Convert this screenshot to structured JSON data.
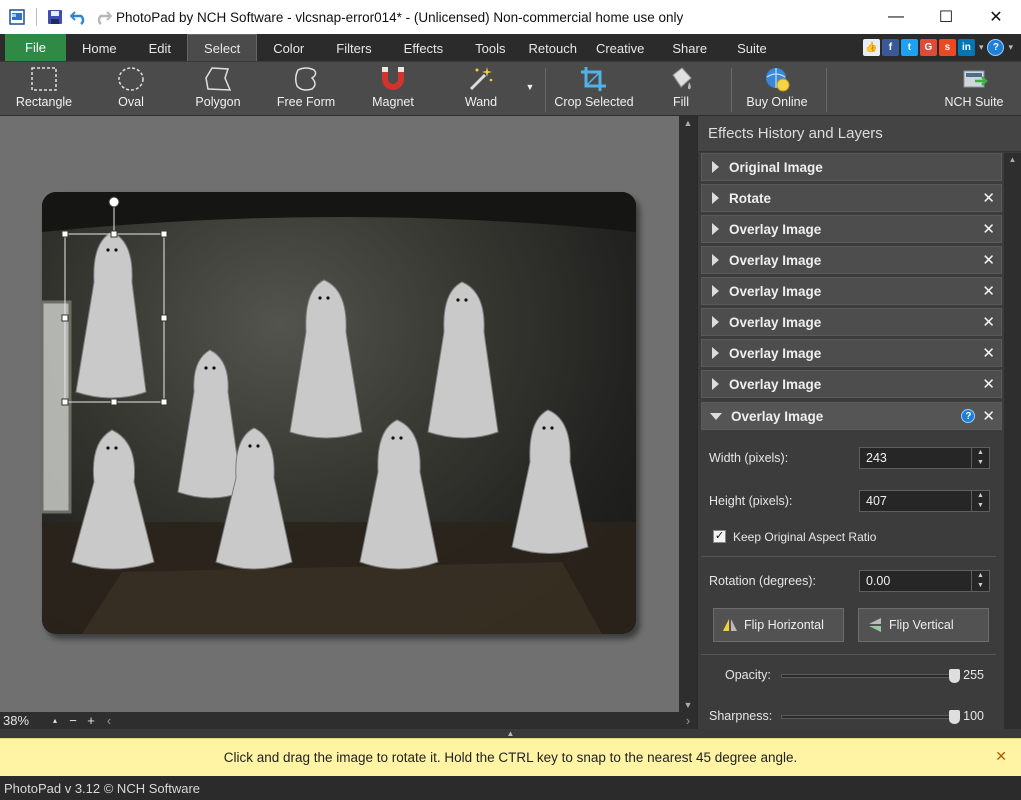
{
  "window": {
    "title": "PhotoPad by NCH Software - vlcsnap-error014* - (Unlicensed) Non-commercial home use only",
    "minimize": "—",
    "maximize": "☐",
    "close": "✕"
  },
  "menu": {
    "tabs": [
      {
        "label": "File"
      },
      {
        "label": "Home"
      },
      {
        "label": "Edit"
      },
      {
        "label": "Select"
      },
      {
        "label": "Color"
      },
      {
        "label": "Filters"
      },
      {
        "label": "Effects"
      },
      {
        "label": "Tools"
      },
      {
        "label": "Retouch"
      },
      {
        "label": "Creative"
      },
      {
        "label": "Share"
      },
      {
        "label": "Suite"
      }
    ],
    "active": "Select",
    "help": "?"
  },
  "toolbar": {
    "rectangle": "Rectangle",
    "oval": "Oval",
    "polygon": "Polygon",
    "free_form": "Free Form",
    "magnet": "Magnet",
    "wand": "Wand",
    "crop_selected": "Crop Selected",
    "fill": "Fill",
    "buy_online": "Buy Online",
    "nch_suite": "NCH Suite"
  },
  "canvas": {
    "zoom": "38%"
  },
  "panel": {
    "title": "Effects History and Layers",
    "layers": [
      {
        "label": "Original Image"
      },
      {
        "label": "Rotate"
      },
      {
        "label": "Overlay Image"
      },
      {
        "label": "Overlay Image"
      },
      {
        "label": "Overlay Image"
      },
      {
        "label": "Overlay Image"
      },
      {
        "label": "Overlay Image"
      },
      {
        "label": "Overlay Image"
      },
      {
        "label": "Overlay Image"
      }
    ],
    "props": {
      "width_label": "Width (pixels):",
      "width_value": "243",
      "height_label": "Height (pixels):",
      "height_value": "407",
      "keep_aspect_label": "Keep Original Aspect Ratio",
      "keep_aspect_checked": true,
      "rotation_label": "Rotation (degrees):",
      "rotation_value": "0.00",
      "flip_h": "Flip Horizontal",
      "flip_v": "Flip Vertical",
      "opacity_label": "Opacity:",
      "opacity_value": "255",
      "sharpness_label": "Sharpness:",
      "sharpness_value": "100"
    }
  },
  "hint": {
    "text": "Click and drag the image to rotate it. Hold the CTRL key to snap to the nearest 45 degree angle."
  },
  "status": {
    "text": "PhotoPad v 3.12 © NCH Software"
  },
  "colors": {
    "file_tab": "#2f8a46",
    "hint_bg": "#fff4a4",
    "panel_bg": "#3c3c3c",
    "canvas_bg": "#707070"
  }
}
